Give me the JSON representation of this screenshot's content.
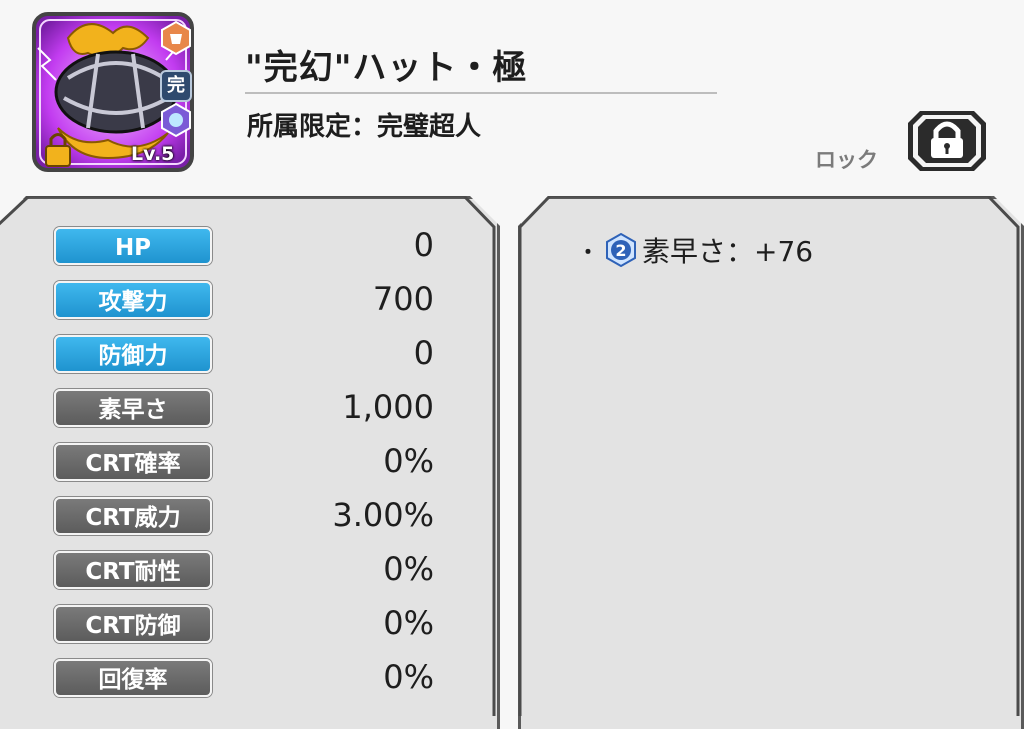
{
  "item": {
    "name": "\"完幻\"ハット・極",
    "affiliation": "所属限定：完璧超人",
    "level": "Lv.5",
    "badge": "完",
    "icon": "hat-equipment-icon"
  },
  "lock": {
    "label": "ロック",
    "icon": "padlock-icon"
  },
  "stats": [
    {
      "label": "HP",
      "value": "0",
      "style": "blue"
    },
    {
      "label": "攻撃力",
      "value": "700",
      "style": "blue"
    },
    {
      "label": "防御力",
      "value": "0",
      "style": "blue"
    },
    {
      "label": "素早さ",
      "value": "1,000",
      "style": "gray"
    },
    {
      "label": "CRT確率",
      "value": "0%",
      "style": "gray"
    },
    {
      "label": "CRT威力",
      "value": "3.00%",
      "style": "gray"
    },
    {
      "label": "CRT耐性",
      "value": "0%",
      "style": "gray"
    },
    {
      "label": "CRT防御",
      "value": "0%",
      "style": "gray"
    },
    {
      "label": "回復率",
      "value": "0%",
      "style": "gray"
    }
  ],
  "effects": [
    {
      "bullet": "・",
      "slot": "2",
      "text": "素早さ：+76"
    }
  ],
  "colors": {
    "stat_blue": "#2aa5e0",
    "stat_gray": "#6b6b6b",
    "aura": "#c23cf0",
    "gold": "#f2b21c"
  }
}
